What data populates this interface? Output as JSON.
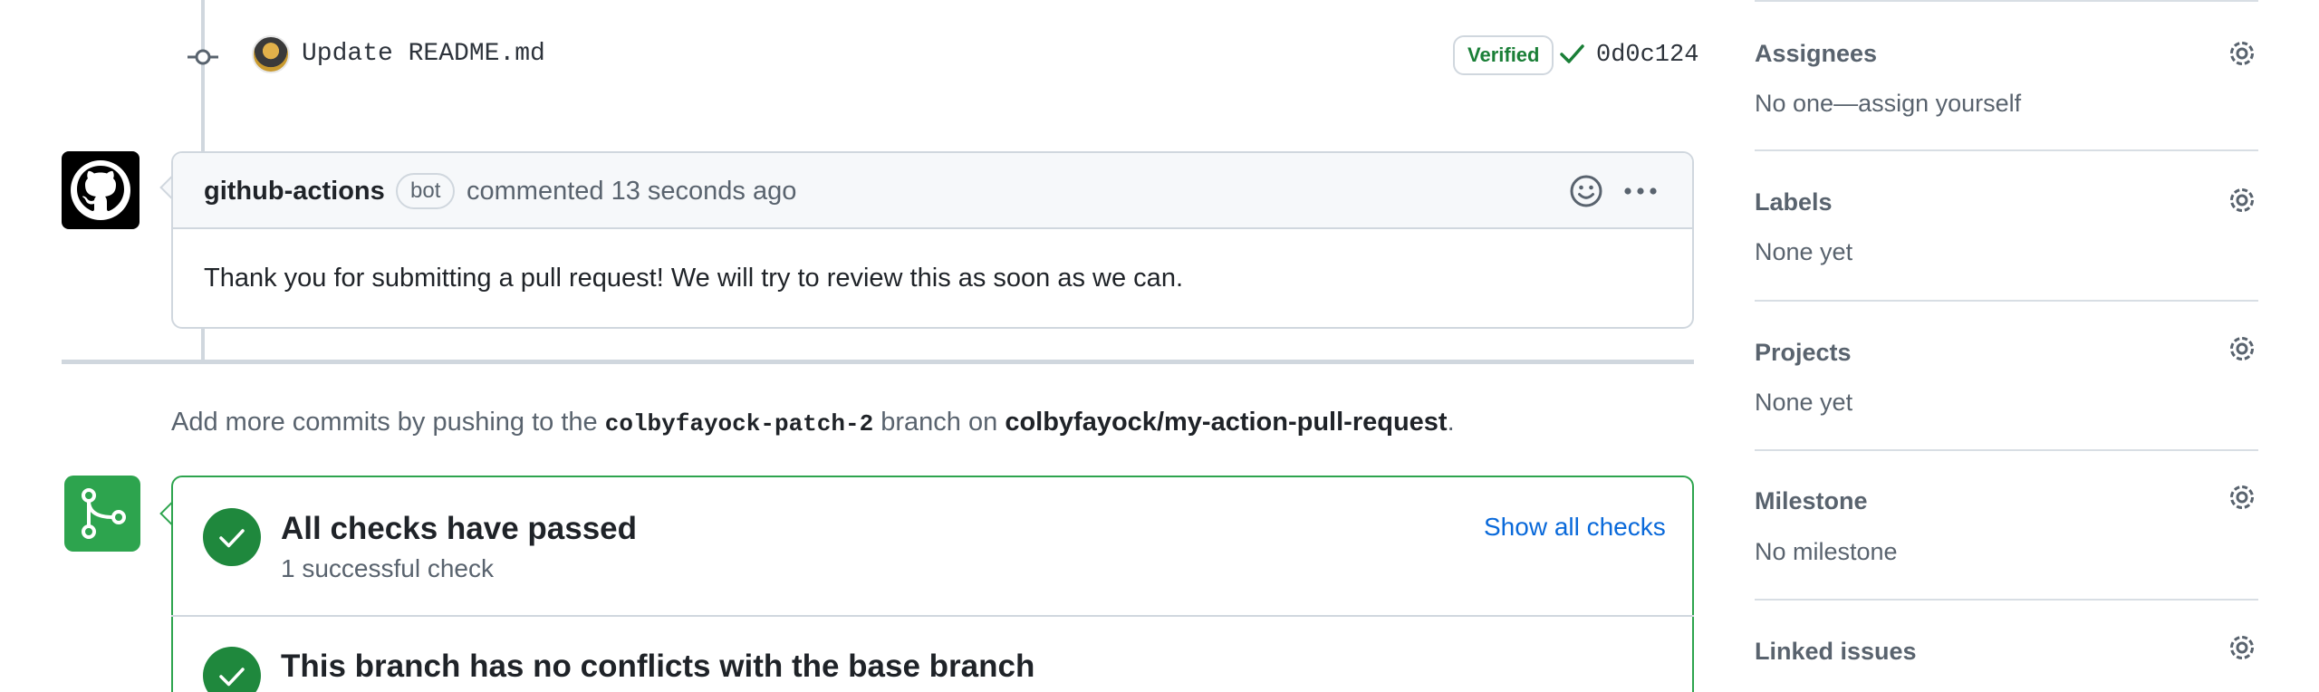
{
  "commit": {
    "message": "Update README.md",
    "verified_label": "Verified",
    "sha": "0d0c124"
  },
  "comment": {
    "author": "github-actions",
    "badge": "bot",
    "meta": "commented 13 seconds ago",
    "body": "Thank you for submitting a pull request! We will try to review this as soon as we can."
  },
  "push_info": {
    "prefix": "Add more commits by pushing to the",
    "branch": "colbyfayock-patch-2",
    "middle": "branch on",
    "repo": "colbyfayock/my-action-pull-request",
    "suffix": "."
  },
  "checks": {
    "title": "All checks have passed",
    "subtitle": "1 successful check",
    "show_all_label": "Show all checks",
    "conflicts_title": "This branch has no conflicts with the base branch"
  },
  "sidebar": {
    "assignees": {
      "title": "Assignees",
      "value": "No one—assign yourself"
    },
    "labels": {
      "title": "Labels",
      "value": "None yet"
    },
    "projects": {
      "title": "Projects",
      "value": "None yet"
    },
    "milestone": {
      "title": "Milestone",
      "value": "No milestone"
    },
    "linked_issues": {
      "title": "Linked issues"
    }
  },
  "colors": {
    "success": "#1f883d",
    "link": "#0969da",
    "border": "#d0d7de"
  }
}
